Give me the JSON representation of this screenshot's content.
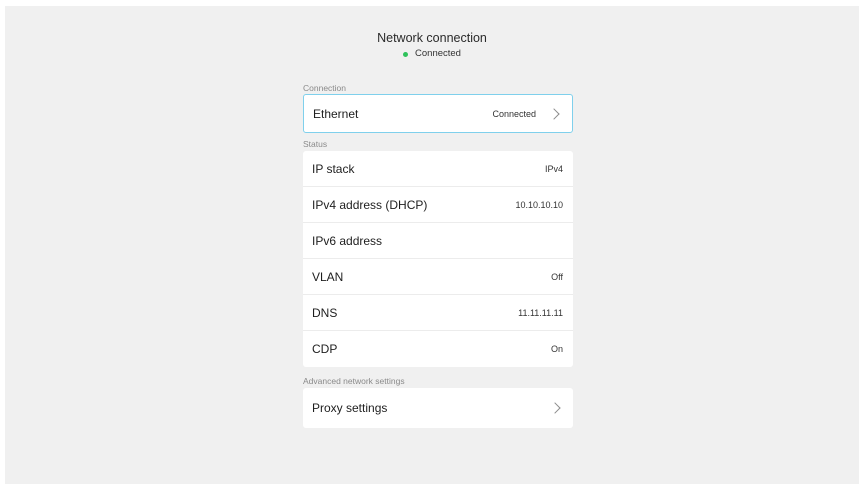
{
  "header": {
    "title": "Network connection",
    "status": "Connected",
    "status_color": "#2fc25b"
  },
  "sections": {
    "connection": {
      "label": "Connection",
      "ethernet_label": "Ethernet",
      "ethernet_value": "Connected"
    },
    "status": {
      "label": "Status",
      "rows": [
        {
          "label": "IP stack",
          "value": "IPv4"
        },
        {
          "label": "IPv4 address (DHCP)",
          "value": "10.10.10.10"
        },
        {
          "label": "IPv6 address",
          "value": ""
        },
        {
          "label": "VLAN",
          "value": "Off"
        },
        {
          "label": "DNS",
          "value": "11.11.11.11"
        },
        {
          "label": "CDP",
          "value": "On"
        }
      ]
    },
    "advanced": {
      "label": "Advanced network settings",
      "proxy_label": "Proxy settings"
    }
  },
  "icons": {
    "chevron": "chevron-right-icon",
    "status_dot": "status-dot-icon"
  },
  "colors": {
    "focus_border": "#7fd0ec",
    "background": "#f0f0f0"
  }
}
